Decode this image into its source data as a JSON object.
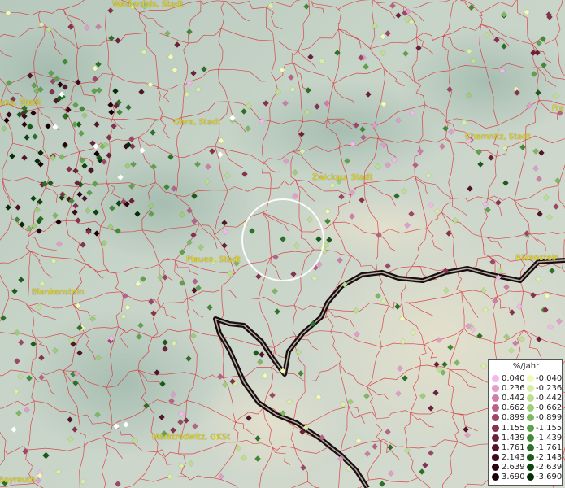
{
  "cities": [
    {
      "id": "weissenfels",
      "label": "Weißenfels, Stadt"
    },
    {
      "id": "jena",
      "label": "Jena, Stadt"
    },
    {
      "id": "gera",
      "label": "Gera, Stadt"
    },
    {
      "id": "zwickau",
      "label": "Zwickau, Stadt"
    },
    {
      "id": "chemnitz",
      "label": "Chemnitz, Stadt"
    },
    {
      "id": "freiberg",
      "label": "Fre"
    },
    {
      "id": "plauen",
      "label": "Plauen, Stadt"
    },
    {
      "id": "blankenstein",
      "label": "Blankenstein"
    },
    {
      "id": "barenstein",
      "label": "Bärenstein"
    },
    {
      "id": "marktredwitz",
      "label": "Marktredwitz, GKSt"
    },
    {
      "id": "bayreuth",
      "label": "Bayreuth"
    }
  ],
  "legend": {
    "title": "%/Jahr",
    "positive": [
      {
        "value": "0.040",
        "color": "#f5b8ec"
      },
      {
        "value": "0.236",
        "color": "#e39ccc"
      },
      {
        "value": "0.442",
        "color": "#cf7ea9"
      },
      {
        "value": "0.662",
        "color": "#b86288"
      },
      {
        "value": "0.899",
        "color": "#9e4668"
      },
      {
        "value": "1.155",
        "color": "#86324f"
      },
      {
        "value": "1.439",
        "color": "#6c213a"
      },
      {
        "value": "1.761",
        "color": "#531428"
      },
      {
        "value": "2.143",
        "color": "#3d0a1b"
      },
      {
        "value": "2.639",
        "color": "#2a0310"
      },
      {
        "value": "3.690",
        "color": "#190007"
      }
    ],
    "negative": [
      {
        "value": "-0.040",
        "color": "#f1fbb8"
      },
      {
        "value": "-0.236",
        "color": "#d8efa8"
      },
      {
        "value": "-0.442",
        "color": "#bde08f"
      },
      {
        "value": "-0.662",
        "color": "#9fcd78"
      },
      {
        "value": "-0.899",
        "color": "#7fb862"
      },
      {
        "value": "-1.155",
        "color": "#5fa24b"
      },
      {
        "value": "-1.439",
        "color": "#438a37"
      },
      {
        "value": "-1.761",
        "color": "#2c7226"
      },
      {
        "value": "-2.143",
        "color": "#195b17"
      },
      {
        "value": "-2.639",
        "color": "#0c450c"
      },
      {
        "value": "-3.690",
        "color": "#032d04"
      }
    ]
  }
}
